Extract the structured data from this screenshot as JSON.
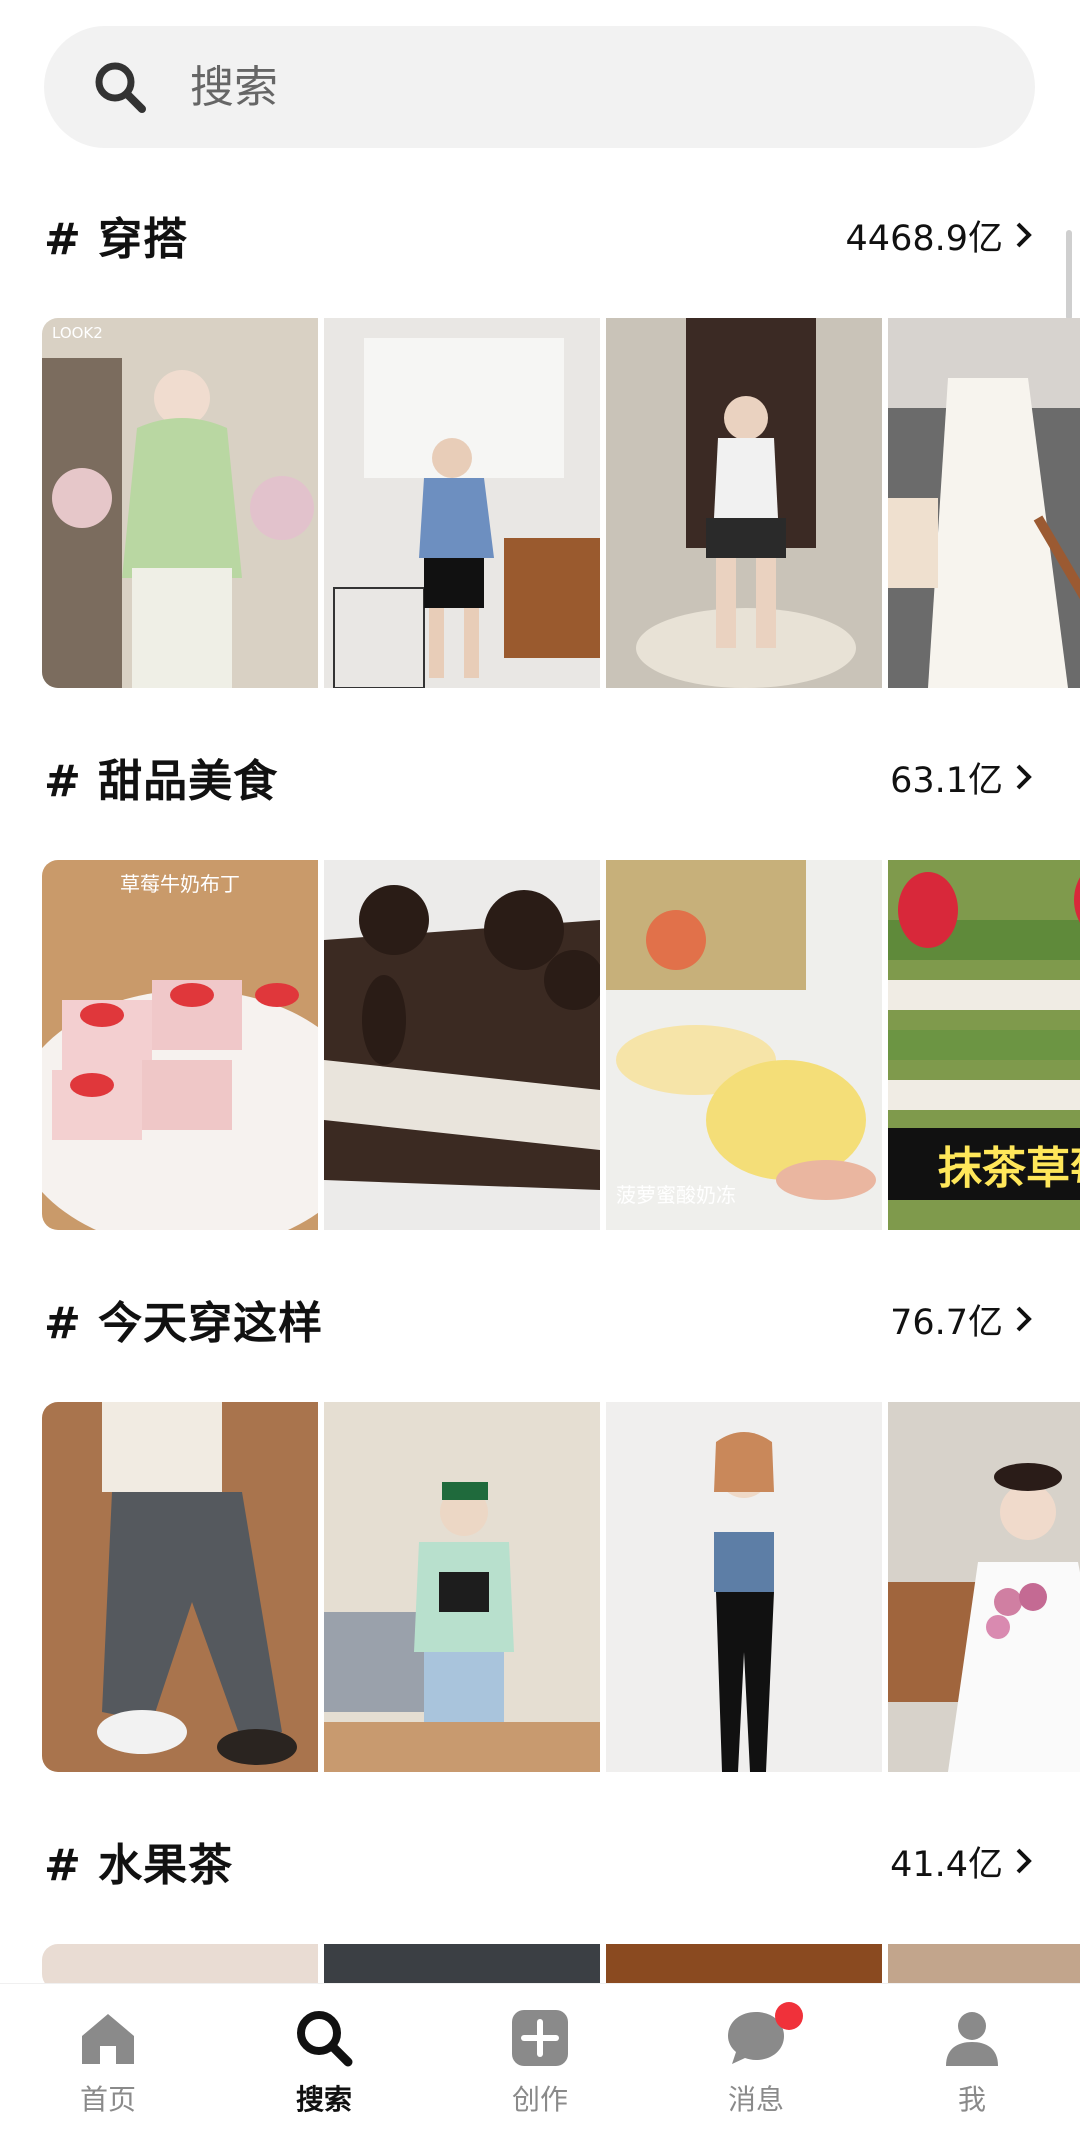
{
  "search": {
    "placeholder": "搜索"
  },
  "sections": [
    {
      "title": "# 穿搭",
      "count": "4468.9亿",
      "thumbs": [
        {
          "caption": "LOOK2"
        },
        {
          "caption": ""
        },
        {
          "caption": ""
        },
        {
          "caption": ""
        }
      ]
    },
    {
      "title": "# 甜品美食",
      "count": "63.1亿",
      "thumbs": [
        {
          "caption": "草莓牛奶布丁"
        },
        {
          "caption": ""
        },
        {
          "caption": "菠萝蜜酸奶冻"
        },
        {
          "caption": "抹茶草莓"
        }
      ]
    },
    {
      "title": "# 今天穿这样",
      "count": "76.7亿",
      "thumbs": [
        {
          "caption": ""
        },
        {
          "caption": ""
        },
        {
          "caption": ""
        },
        {
          "caption": ""
        }
      ]
    },
    {
      "title": "# 水果茶",
      "count": "41.4亿",
      "thumbs": [
        {
          "caption": ""
        },
        {
          "caption": ""
        },
        {
          "caption": ""
        },
        {
          "caption": ""
        }
      ]
    }
  ],
  "nav": {
    "items": [
      {
        "label": "首页",
        "icon": "home-icon",
        "active": false
      },
      {
        "label": "搜索",
        "icon": "search-icon",
        "active": true
      },
      {
        "label": "创作",
        "icon": "create-icon",
        "active": false
      },
      {
        "label": "消息",
        "icon": "message-icon",
        "active": false,
        "badge": true
      },
      {
        "label": "我",
        "icon": "profile-icon",
        "active": false
      }
    ]
  },
  "colors": {
    "badge": "#f0313a",
    "search_bg": "#f2f2f2",
    "nav_inactive": "#8a8a8a"
  }
}
